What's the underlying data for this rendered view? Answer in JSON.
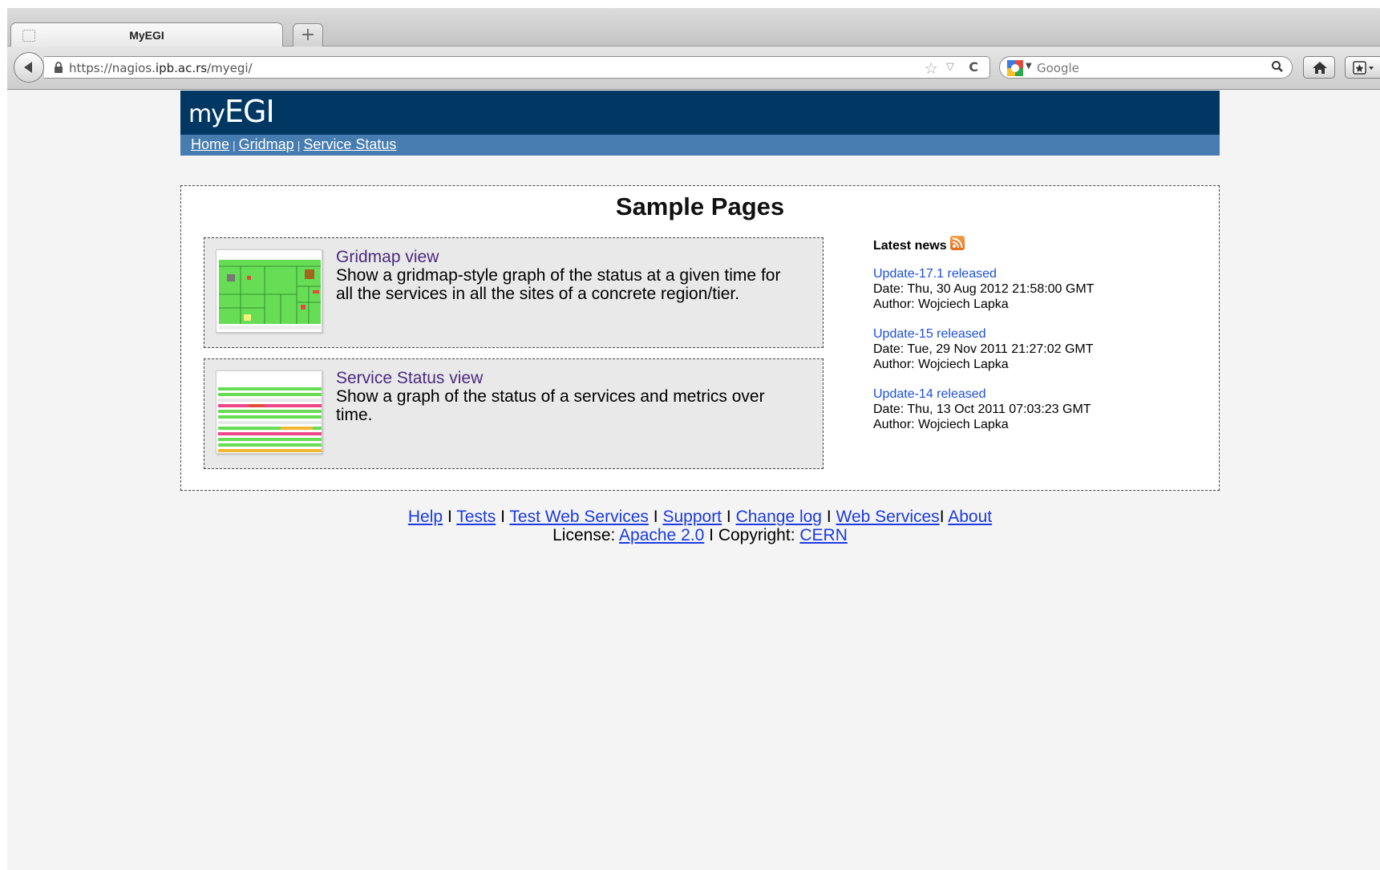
{
  "browser": {
    "tab_title": "MyEGI",
    "new_tab_symbol": "+",
    "url_host_prefix": "https://nagios.",
    "url_host_main": "ipb.ac.rs",
    "url_path": "/myegi/",
    "search_engine": "Google",
    "search_placeholder": "Google"
  },
  "site": {
    "logo_prefix": "my",
    "logo_main": "EGI",
    "nav": [
      {
        "label": "Home"
      },
      {
        "label": "Gridmap"
      },
      {
        "label": "Service Status"
      }
    ]
  },
  "main": {
    "title": "Sample Pages",
    "cards": [
      {
        "link": "Gridmap view",
        "description": "Show a gridmap-style graph of the status at a given time for all the services in all the sites of a concrete region/tier."
      },
      {
        "link": "Service Status view",
        "description": "Show a graph of the status of a services and metrics over time."
      }
    ]
  },
  "news": {
    "heading": "Latest news",
    "items": [
      {
        "title": "Update-17.1 released",
        "date": "Date: Thu, 30 Aug 2012 21:58:00 GMT",
        "author": "Author: Wojciech Lapka"
      },
      {
        "title": "Update-15 released",
        "date": "Date: Tue, 29 Nov 2011 21:27:02 GMT",
        "author": "Author: Wojciech Lapka"
      },
      {
        "title": "Update-14 released",
        "date": "Date: Thu, 13 Oct 2011 07:03:23 GMT",
        "author": "Author: Wojciech Lapka"
      }
    ]
  },
  "footer": {
    "help": "Help",
    "tests": "Tests",
    "test_ws": "Test Web Services",
    "support": "Support",
    "changelog": "Change log",
    "web_services": "Web Services",
    "about": "About",
    "license_label": "License:",
    "license_link": "Apache 2.0",
    "copyright_label": "Copyright:",
    "copyright_link": "CERN",
    "separator": "I"
  },
  "colors": {
    "header_bg": "#003763",
    "nav_bg": "#467cb0",
    "card_link": "#4b2a7f",
    "news_link": "#1d4fd8",
    "footer_link": "#1a3ae0"
  }
}
